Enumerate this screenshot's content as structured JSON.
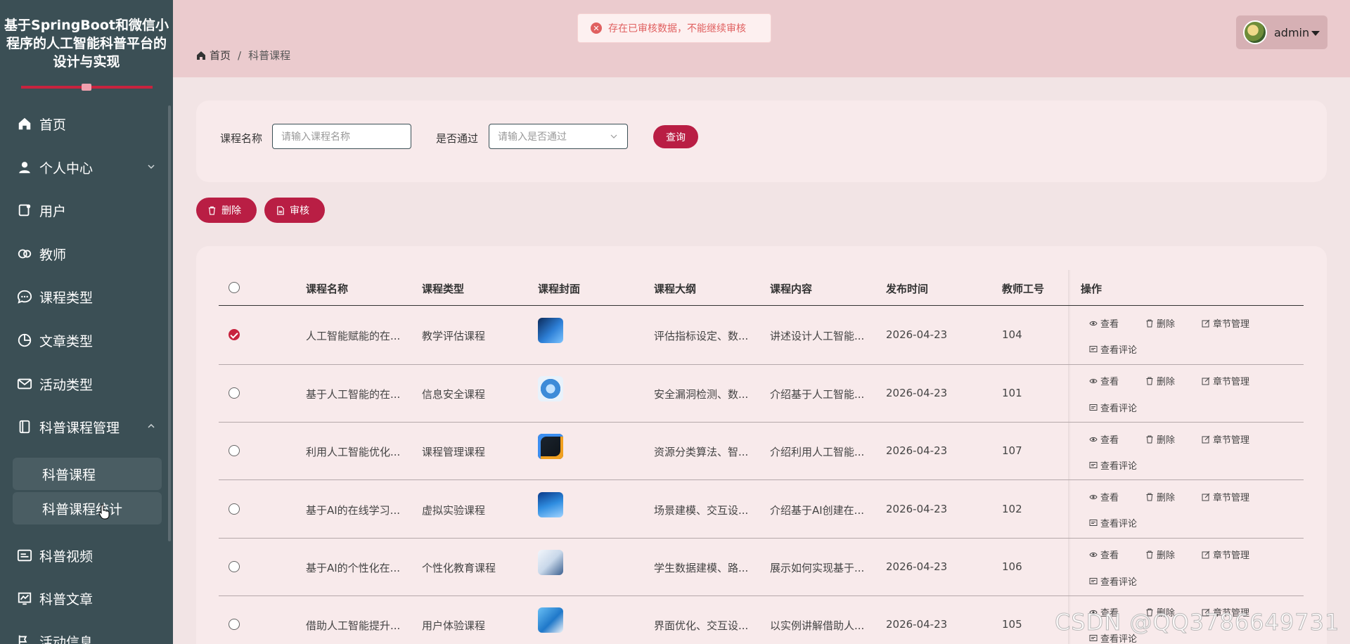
{
  "sidebar": {
    "title": "基于SpringBoot和微信小程序的人工智能科普平台的设计与实现",
    "items": [
      {
        "label": "首页",
        "icon": "home-icon"
      },
      {
        "label": "个人中心",
        "icon": "user-icon"
      },
      {
        "label": "用户",
        "icon": "user-card-icon"
      },
      {
        "label": "教师",
        "icon": "teacher-icon"
      },
      {
        "label": "课程类型",
        "icon": "chat-icon"
      },
      {
        "label": "文章类型",
        "icon": "pie-icon"
      },
      {
        "label": "活动类型",
        "icon": "mail-icon"
      },
      {
        "label": "科普课程管理",
        "icon": "course-icon"
      },
      {
        "label": "科普视频",
        "icon": "video-icon"
      },
      {
        "label": "科普文章",
        "icon": "article-icon"
      },
      {
        "label": "活动信息",
        "icon": "activity-icon"
      }
    ],
    "subitems": [
      "科普课程",
      "科普课程统计"
    ]
  },
  "header": {
    "breadcrumb_home": "首页",
    "breadcrumb_separator": "/",
    "breadcrumb_current": "科普课程",
    "user": "admin"
  },
  "toast": {
    "message": "存在已审核数据，不能继续审核"
  },
  "search": {
    "course_name_label": "课程名称",
    "course_name_placeholder": "请输入课程名称",
    "pass_label": "是否通过",
    "pass_placeholder": "请输入是否通过",
    "query_button": "查询"
  },
  "actions": {
    "delete": "删除",
    "review": "审核"
  },
  "table": {
    "headers": [
      "课程名称",
      "课程类型",
      "课程封面",
      "课程大纲",
      "课程内容",
      "发布时间",
      "教师工号",
      "操作"
    ],
    "row_actions": {
      "view": "查看",
      "delete": "删除",
      "chapters": "章节管理",
      "comments": "查看评论"
    },
    "rows": [
      {
        "name": "人工智能赋能的在...",
        "type": "教学评估课程",
        "outline": "评估指标设定、数...",
        "content": "讲述设计人工智能...",
        "date": "2026-04-23",
        "teacher": "104",
        "checked": true
      },
      {
        "name": "基于人工智能的在...",
        "type": "信息安全课程",
        "outline": "安全漏洞检测、数...",
        "content": "介绍基于人工智能...",
        "date": "2026-04-23",
        "teacher": "101",
        "checked": false
      },
      {
        "name": "利用人工智能优化...",
        "type": "课程管理课程",
        "outline": "资源分类算法、智...",
        "content": "介绍利用人工智能...",
        "date": "2026-04-23",
        "teacher": "107",
        "checked": false
      },
      {
        "name": "基于AI的在线学习...",
        "type": "虚拟实验课程",
        "outline": "场景建模、交互设...",
        "content": "介绍基于AI创建在...",
        "date": "2026-04-23",
        "teacher": "102",
        "checked": false
      },
      {
        "name": "基于AI的个性化在...",
        "type": "个性化教育课程",
        "outline": "学生数据建模、路...",
        "content": "展示如何实现基于...",
        "date": "2026-04-23",
        "teacher": "106",
        "checked": false
      },
      {
        "name": "借助人工智能提升...",
        "type": "用户体验课程",
        "outline": "界面优化、交互设...",
        "content": "以实例讲解借助人...",
        "date": "2026-04-23",
        "teacher": "105",
        "checked": false
      }
    ]
  },
  "watermark": "CSDN @QQ3786649731",
  "colors": {
    "sidebar": "#3b4f55",
    "accent": "#b91e44",
    "header": "#ebcbce",
    "page": "#f2e4e5",
    "card": "#f8eaeb"
  }
}
